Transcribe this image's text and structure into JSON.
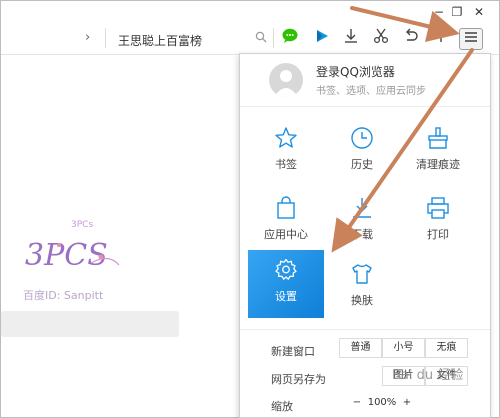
{
  "window": {
    "minimize": "−",
    "restore": "❐",
    "close": "✕"
  },
  "toolbar": {
    "address_text": "王思聪上百富榜",
    "chevron": "›"
  },
  "logo": {
    "text": "3PCS",
    "small": "3PCs",
    "baidu_id": "百度ID: Sanpitt"
  },
  "menu_panel": {
    "login_title": "登录QQ浏览器",
    "login_subtitle": "书签、选项、应用云同步",
    "grid": [
      {
        "label": "书签"
      },
      {
        "label": "历史"
      },
      {
        "label": "清理痕迹"
      },
      {
        "label": "应用中心"
      },
      {
        "label": "下载"
      },
      {
        "label": "打印"
      },
      {
        "label": "设置"
      },
      {
        "label": "换肤"
      }
    ],
    "new_window": {
      "label": "新建窗口",
      "options": [
        "普通",
        "小号",
        "无痕"
      ]
    },
    "save_as": {
      "label": "网页另存为",
      "options": [
        "图片",
        "文件"
      ]
    },
    "zoom": {
      "label": "缩放",
      "minus": "−",
      "value": "100%",
      "plus": "+"
    }
  },
  "watermark": "Bai du 经验",
  "colors": {
    "accent": "#1890e8",
    "arrow": "#c9825a",
    "wechat_green": "#2dc100",
    "play_blue": "#1296db"
  }
}
